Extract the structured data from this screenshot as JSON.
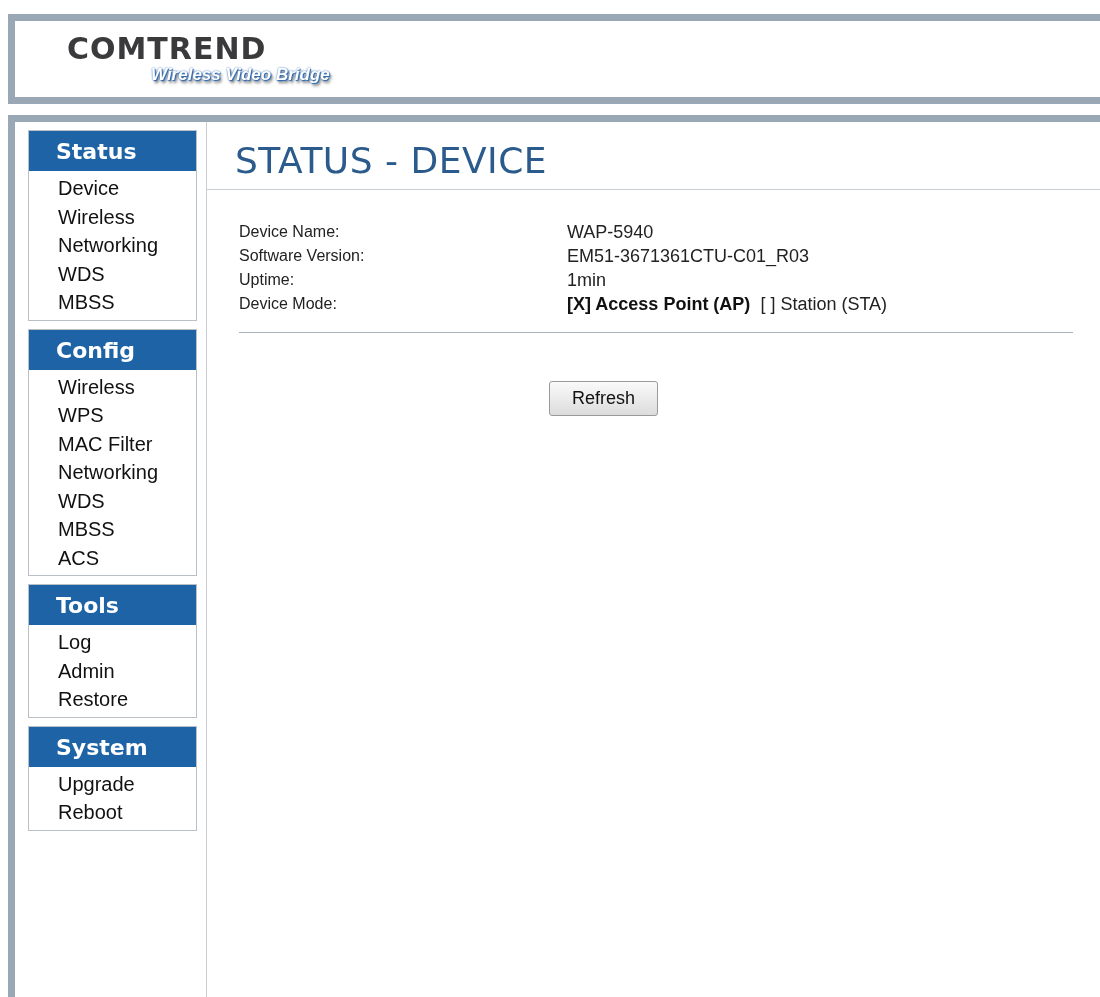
{
  "header": {
    "brand": "COMTREND",
    "product": "Wireless Video Bridge"
  },
  "sidebar": [
    {
      "title": "Status",
      "items": [
        "Device",
        "Wireless",
        "Networking",
        "WDS",
        "MBSS"
      ]
    },
    {
      "title": "Config",
      "items": [
        "Wireless",
        "WPS",
        "MAC Filter",
        "Networking",
        "WDS",
        "MBSS",
        "ACS"
      ]
    },
    {
      "title": "Tools",
      "items": [
        "Log",
        "Admin",
        "Restore"
      ]
    },
    {
      "title": "System",
      "items": [
        "Upgrade",
        "Reboot"
      ]
    }
  ],
  "page_title": "STATUS - DEVICE",
  "fields": [
    {
      "label": "Device Name:",
      "value": "WAP-5940"
    },
    {
      "label": "Software Version:",
      "value": "EM51-3671361CTU-C01_R03"
    },
    {
      "label": "Uptime:",
      "value": "1min"
    }
  ],
  "device_mode": {
    "label": "Device Mode:",
    "options": [
      {
        "label": "[X] Access Point (AP)",
        "selected": true
      },
      {
        "label": "[ ] Station (STA)",
        "selected": false
      }
    ]
  },
  "buttons": [
    "Refresh"
  ]
}
